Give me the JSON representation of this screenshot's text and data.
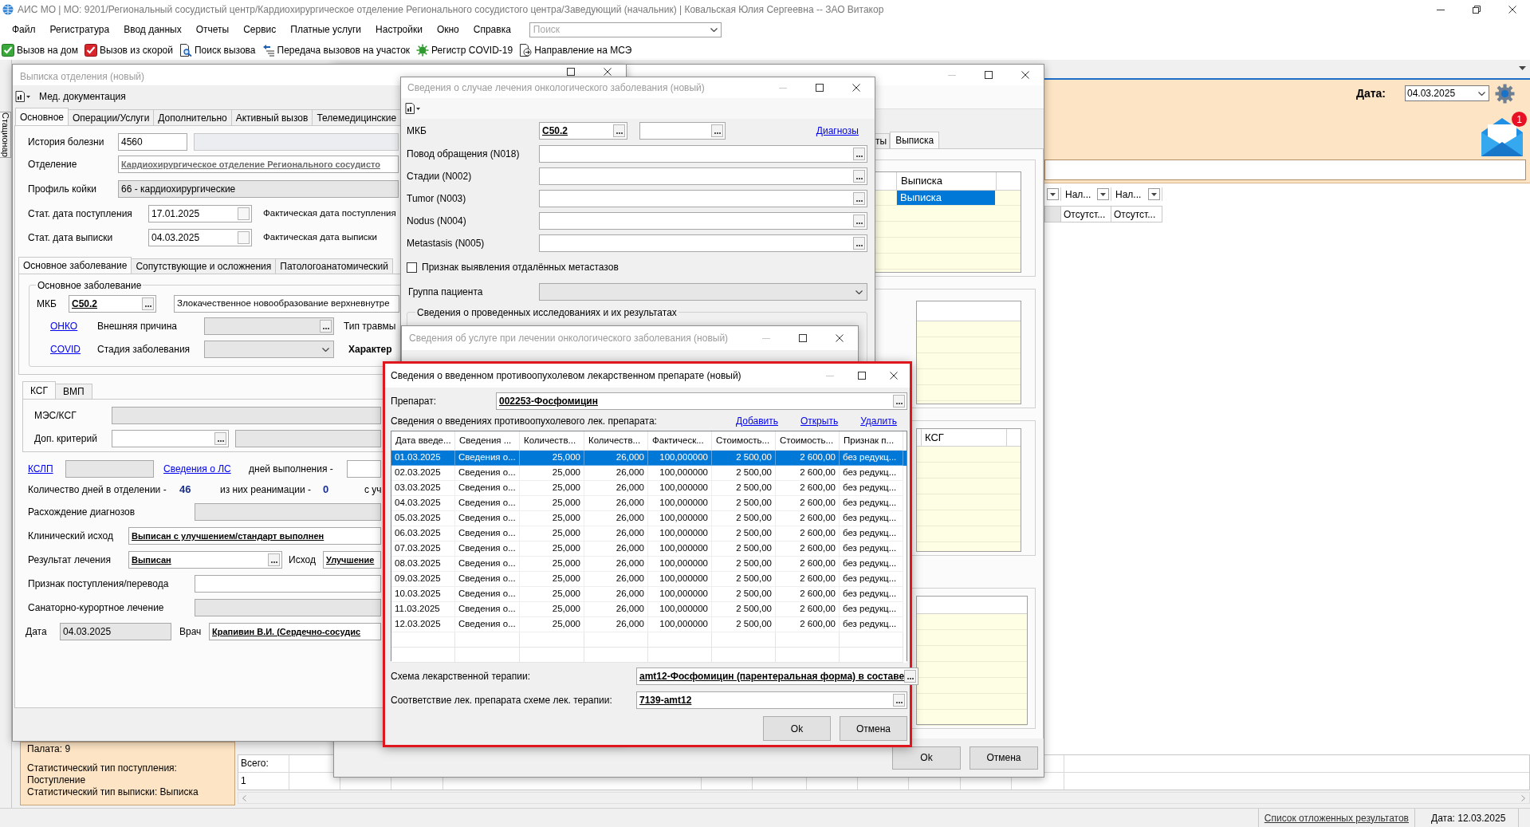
{
  "window": {
    "title": "АИС МО | МО: 9201/Региональный сосудистый центр/Кардиохирургическое отделение Регионального сосудистого центра/Заведующий (начальник) | Ковальская Юлия Сергеевна -- ЗАО Витакор"
  },
  "menu": [
    "Файл",
    "Регистратура",
    "Ввод данных",
    "Отчеты",
    "Сервис",
    "Платные услуги",
    "Настройки",
    "Окно",
    "Справка"
  ],
  "search": {
    "placeholder": "Поиск"
  },
  "toolbar": [
    "Вызов на дом",
    "Вызов из скорой",
    "Поиск вызова",
    "Передача вызовов на участок",
    "Регистр COVID-19",
    "Направление на МСЭ"
  ],
  "side_tab": "Стационар",
  "header_panel": {
    "date_label": "Дата:",
    "date": "04.03.2025",
    "mail_badge": "1"
  },
  "main_grid": {
    "columns": [
      "Нал...",
      "Нал..."
    ],
    "rows": [
      [
        "Отсутст...",
        "Отсутст..."
      ]
    ]
  },
  "patient_panel": {
    "lines": [
      "Палата: 9",
      "Статистический тип поступления:",
      "Поступление",
      "Статистический тип выписки: Выписка"
    ]
  },
  "totals_grid": {
    "label": "Всего:",
    "value": "1"
  },
  "status_bar": {
    "link": "Список отложенных результатов",
    "date": "Дата: 12.03.2025"
  },
  "back_window": {
    "tabs": [
      {
        "label": "ты",
        "selected": false
      },
      {
        "label": "Выписка",
        "selected": true
      }
    ],
    "grid_1": {
      "column": "Выписка",
      "rows": [
        {
          "value": "Выписка",
          "selected": true
        }
      ]
    },
    "grid_3": {
      "column": "КСГ"
    },
    "buttons": [
      "Ok",
      "Отмена"
    ]
  },
  "discharge_window": {
    "title": "Выписка отделения (новый)",
    "active": false,
    "toolbar_label": "Мед. документация",
    "tabs": [
      {
        "label": "Основное",
        "selected": true
      },
      {
        "label": "Операции/Услуги",
        "selected": false
      },
      {
        "label": "Дополнительно",
        "selected": false
      },
      {
        "label": "Активный вызов",
        "selected": false
      },
      {
        "label": "Телемедицинские",
        "selected": false
      }
    ],
    "case_history": {
      "label": "История болезни",
      "value": "4560"
    },
    "department": {
      "label": "Отделение",
      "value": "Кардиохирургическое отделение Регионального сосудисто"
    },
    "bed_profile": {
      "label": "Профиль койки",
      "value": "66 - кардиохирургические"
    },
    "dates": [
      {
        "label": "Стат. дата поступления",
        "value": "17.01.2025",
        "actual_label": "Фактическая дата поступления"
      },
      {
        "label": "Стат. дата выписки",
        "value": "04.03.2025",
        "actual_label": "Фактическая дата выписки"
      }
    ],
    "diagnosis_tabs": [
      {
        "label": "Основное заболевание",
        "selected": true
      },
      {
        "label": "Сопутствующие и осложнения",
        "selected": false
      },
      {
        "label": "Патологоанатомический",
        "selected": false
      }
    ],
    "main_disease": {
      "legend": "Основное заболевание",
      "mkb_label": "МКБ",
      "mkb": "C50.2",
      "mkb_name": "Злокачественное новообразование верхневнутре",
      "onko_link": "ОНКО",
      "external_cause_label": "Внешняя причина",
      "injury_type_label": "Тип травмы",
      "covid_link": "COVID",
      "stage_label": "Стадия заболевания",
      "character_label": "Характер"
    },
    "ksg_tabs": [
      {
        "label": "КСГ",
        "selected": true
      },
      {
        "label": "ВМП",
        "selected": false
      }
    ],
    "mes_label": "МЭС/КСГ",
    "criterion_label": "Доп. критерий",
    "kslp_link": "КСЛП",
    "drugs_link": "Сведения о ЛС",
    "days_done_label": "дней выполнения -",
    "days": {
      "label": "Количество дней в отделении -",
      "value": "46",
      "icu_label": "из них реанимации -",
      "icu_value": "0",
      "tail": "с уч"
    },
    "outcome_fields": [
      {
        "kind": "plain",
        "label": "Расхождение диагнозов",
        "disabled": true
      },
      {
        "kind": "lookup",
        "label": "Клинический исход",
        "value": "Выписан с улучшением/стандарт выполнен",
        "disabled": false
      },
      {
        "kind": "pair",
        "label": "Результат лечения",
        "value": "Выписан",
        "second_label": "Исход",
        "second_value": "Улучшение",
        "disabled": false
      },
      {
        "kind": "plain",
        "label": "Признак поступления/перевода",
        "disabled": false
      },
      {
        "kind": "plain",
        "label": "Санаторно-курортное лечение",
        "disabled": true
      },
      {
        "kind": "dated",
        "label": "Дата",
        "value": "04.03.2025",
        "second_label": "Врач",
        "second_value": "Крапивин В.И. (Сердечно-сосудис",
        "disabled": true
      }
    ]
  },
  "onco_window": {
    "title": "Сведения о случае лечения онкологического заболевания (новый)",
    "active": false,
    "mkb_label": "МКБ",
    "mkb": "C50.2",
    "diagnoses_link": "Диагнозы",
    "fields": [
      "Повод обращения (N018)",
      "Стадии (N002)",
      "Tumor (N003)",
      "Nodus (N004)",
      "Metastasis (N005)"
    ],
    "metastasis": {
      "label": "Признак выявления отдалённых метастазов",
      "checked": false
    },
    "patient_group_label": "Группа пациента",
    "research_legend": "Сведения о проведенных исследованиях и их результатах"
  },
  "service_window": {
    "title": "Сведения об услуге при лечении онкологического заболевания (новый)",
    "active": false
  },
  "drug_window": {
    "title": "Сведения о введенном противоопухолевом лекарственном препарате (новый)",
    "active": true,
    "drug_label": "Препарат:",
    "drug": "002253-Фосфомицин",
    "list_label": "Сведения о введениях противоопухолевого лек. препарата:",
    "actions": [
      "Добавить",
      "Открыть",
      "Удалить"
    ],
    "columns": [
      "Дата введе...",
      "Сведения ...",
      "Количеств...",
      "Количеств...",
      "Фактическ...",
      "Стоимость...",
      "Стоимость...",
      "Признак п..."
    ],
    "rows": [
      {
        "cells": [
          "01.03.2025",
          "Сведения о...",
          "25,000",
          "26,000",
          "100,000000",
          "2 500,00",
          "2 600,00",
          "без редукц..."
        ],
        "selected": true
      },
      {
        "cells": [
          "02.03.2025",
          "Сведения о...",
          "25,000",
          "26,000",
          "100,000000",
          "2 500,00",
          "2 600,00",
          "без редукц..."
        ],
        "selected": false
      },
      {
        "cells": [
          "03.03.2025",
          "Сведения о...",
          "25,000",
          "26,000",
          "100,000000",
          "2 500,00",
          "2 600,00",
          "без редукц..."
        ],
        "selected": false
      },
      {
        "cells": [
          "04.03.2025",
          "Сведения о...",
          "25,000",
          "26,000",
          "100,000000",
          "2 500,00",
          "2 600,00",
          "без редукц..."
        ],
        "selected": false
      },
      {
        "cells": [
          "05.03.2025",
          "Сведения о...",
          "25,000",
          "26,000",
          "100,000000",
          "2 500,00",
          "2 600,00",
          "без редукц..."
        ],
        "selected": false
      },
      {
        "cells": [
          "06.03.2025",
          "Сведения о...",
          "25,000",
          "26,000",
          "100,000000",
          "2 500,00",
          "2 600,00",
          "без редукц..."
        ],
        "selected": false
      },
      {
        "cells": [
          "07.03.2025",
          "Сведения о...",
          "25,000",
          "26,000",
          "100,000000",
          "2 500,00",
          "2 600,00",
          "без редукц..."
        ],
        "selected": false
      },
      {
        "cells": [
          "08.03.2025",
          "Сведения о...",
          "25,000",
          "26,000",
          "100,000000",
          "2 500,00",
          "2 600,00",
          "без редукц..."
        ],
        "selected": false
      },
      {
        "cells": [
          "09.03.2025",
          "Сведения о...",
          "25,000",
          "26,000",
          "100,000000",
          "2 500,00",
          "2 600,00",
          "без редукц..."
        ],
        "selected": false
      },
      {
        "cells": [
          "10.03.2025",
          "Сведения о...",
          "25,000",
          "26,000",
          "100,000000",
          "2 500,00",
          "2 600,00",
          "без редукц..."
        ],
        "selected": false
      },
      {
        "cells": [
          "11.03.2025",
          "Сведения о...",
          "25,000",
          "26,000",
          "100,000000",
          "2 500,00",
          "2 600,00",
          "без редукц..."
        ],
        "selected": false
      },
      {
        "cells": [
          "12.03.2025",
          "Сведения о...",
          "25,000",
          "26,000",
          "100,000000",
          "2 500,00",
          "2 600,00",
          "без редукц..."
        ],
        "selected": false
      }
    ],
    "scheme_label": "Схема лекарственной терапии:",
    "scheme": "amt12-Фосфомицин (парентеральная форма) в составе",
    "match_label": "Соответствие лек. препарата схеме лек. терапии:",
    "match": "7139-amt12",
    "buttons": [
      "Ok",
      "Отмена"
    ]
  }
}
